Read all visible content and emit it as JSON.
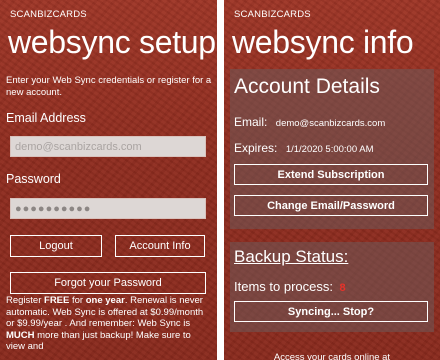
{
  "left_screen": {
    "app_name": "SCANBIZCARDS",
    "title": "websync setup",
    "intro_text": "Enter your Web Sync credentials or register for a new account.",
    "email": {
      "label": "Email Address",
      "placeholder": "demo@scanbizcards.com"
    },
    "password": {
      "label": "Password",
      "value": "●●●●●●●●●●"
    },
    "buttons": {
      "logout": "Logout",
      "account_info": "Account Info",
      "forgot_password": "Forgot your Password"
    },
    "register": {
      "t1": "Register ",
      "free": "FREE",
      "t2": " for ",
      "one_year": "one year",
      "t3": ". Renewal is never automatic. Web Sync is offered at $0.99/month or $9.99/year .  And remember: Web Sync is ",
      "much": "MUCH",
      "t4": " more than just backup! Make sure to view and"
    }
  },
  "right_screen": {
    "app_name": "SCANBIZCARDS",
    "title": "websync info",
    "account_details": {
      "heading": "Account Details",
      "email_label": "Email:",
      "email_value": "demo@scanbizcards.com",
      "expires_label": "Expires:",
      "expires_value": "1/1/2020 5:00:00 AM",
      "extend_button": "Extend Subscription",
      "change_button": "Change Email/Password"
    },
    "backup_status": {
      "heading": "Backup Status:",
      "items_label": "Items to process:",
      "items_count": "8",
      "sync_button": "Syncing... Stop?"
    },
    "footer_text": "Access your cards online at"
  },
  "colors": {
    "background": "#8f2c1f",
    "panel": "#6e5a5a",
    "input_bg": "#ddd7d5",
    "badge": "#e8322a"
  }
}
